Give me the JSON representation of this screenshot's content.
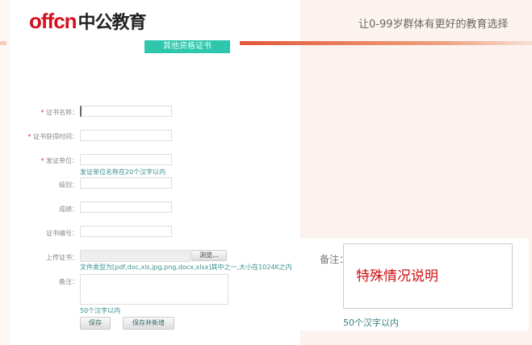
{
  "header": {
    "logo_latin": "offcn",
    "logo_cn": "中公教育",
    "slogan": "让0-99岁群体有更好的教育选择"
  },
  "section_title": "其他资格证书",
  "form": {
    "fields": [
      {
        "label": "证书名称：",
        "required": true,
        "value": ""
      },
      {
        "label": "证书获得时间：",
        "required": true,
        "value": ""
      },
      {
        "label": "发证单位：",
        "required": true,
        "value": "",
        "hint": "发证单位名称在20个汉字以内"
      },
      {
        "label": "级别：",
        "required": false,
        "value": ""
      },
      {
        "label": "成绩：",
        "required": false,
        "value": ""
      },
      {
        "label": "证书编号：",
        "required": false,
        "value": ""
      }
    ],
    "required_mark": "*",
    "upload": {
      "label": "上传证书：",
      "browse": "浏览...",
      "hint": "文件类型为[pdf,doc,xls,jpg,png,docx,xlsx]其中之一,大小在1024K之内"
    },
    "remark": {
      "label": "备注：",
      "hint": "50个汉字以内"
    },
    "save": "保存",
    "save_new": "保存并新增"
  },
  "zoom_callout": {
    "label": "备注：",
    "annotation": "特殊情况说明",
    "hint": "50个汉字以内"
  }
}
